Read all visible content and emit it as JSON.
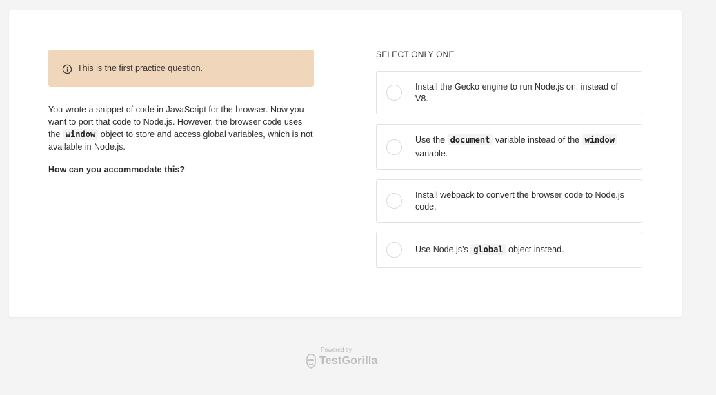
{
  "notice": {
    "icon": "info-icon",
    "text": "This is the first practice question."
  },
  "question": {
    "part1": "You wrote a snippet of code in JavaScript for the browser. Now you want to port that code to Node.js. However, the browser code uses the ",
    "code1": "window",
    "part2": " object to store and access global variables, which is not available in Node.js.",
    "prompt": "How can you accommodate this?"
  },
  "select_label": "SELECT ONLY ONE",
  "options": [
    {
      "text": "Install the Gecko engine to run Node.js on, instead of V8."
    },
    {
      "pre": "Use the ",
      "code_a": "document",
      "mid": " variable instead of the ",
      "code_b": "window",
      "post": " variable."
    },
    {
      "text": "Install webpack to convert the browser code to Node.js code."
    },
    {
      "pre": "Use Node.js's ",
      "code_a": "global",
      "post": " object instead."
    }
  ],
  "footer": {
    "powered": "Powered by",
    "brand": "TestGorilla",
    "logo": "gorilla-logo-icon"
  },
  "colors": {
    "notice_bg": "#f0d7bb",
    "page_bg": "#f3f4f3"
  }
}
